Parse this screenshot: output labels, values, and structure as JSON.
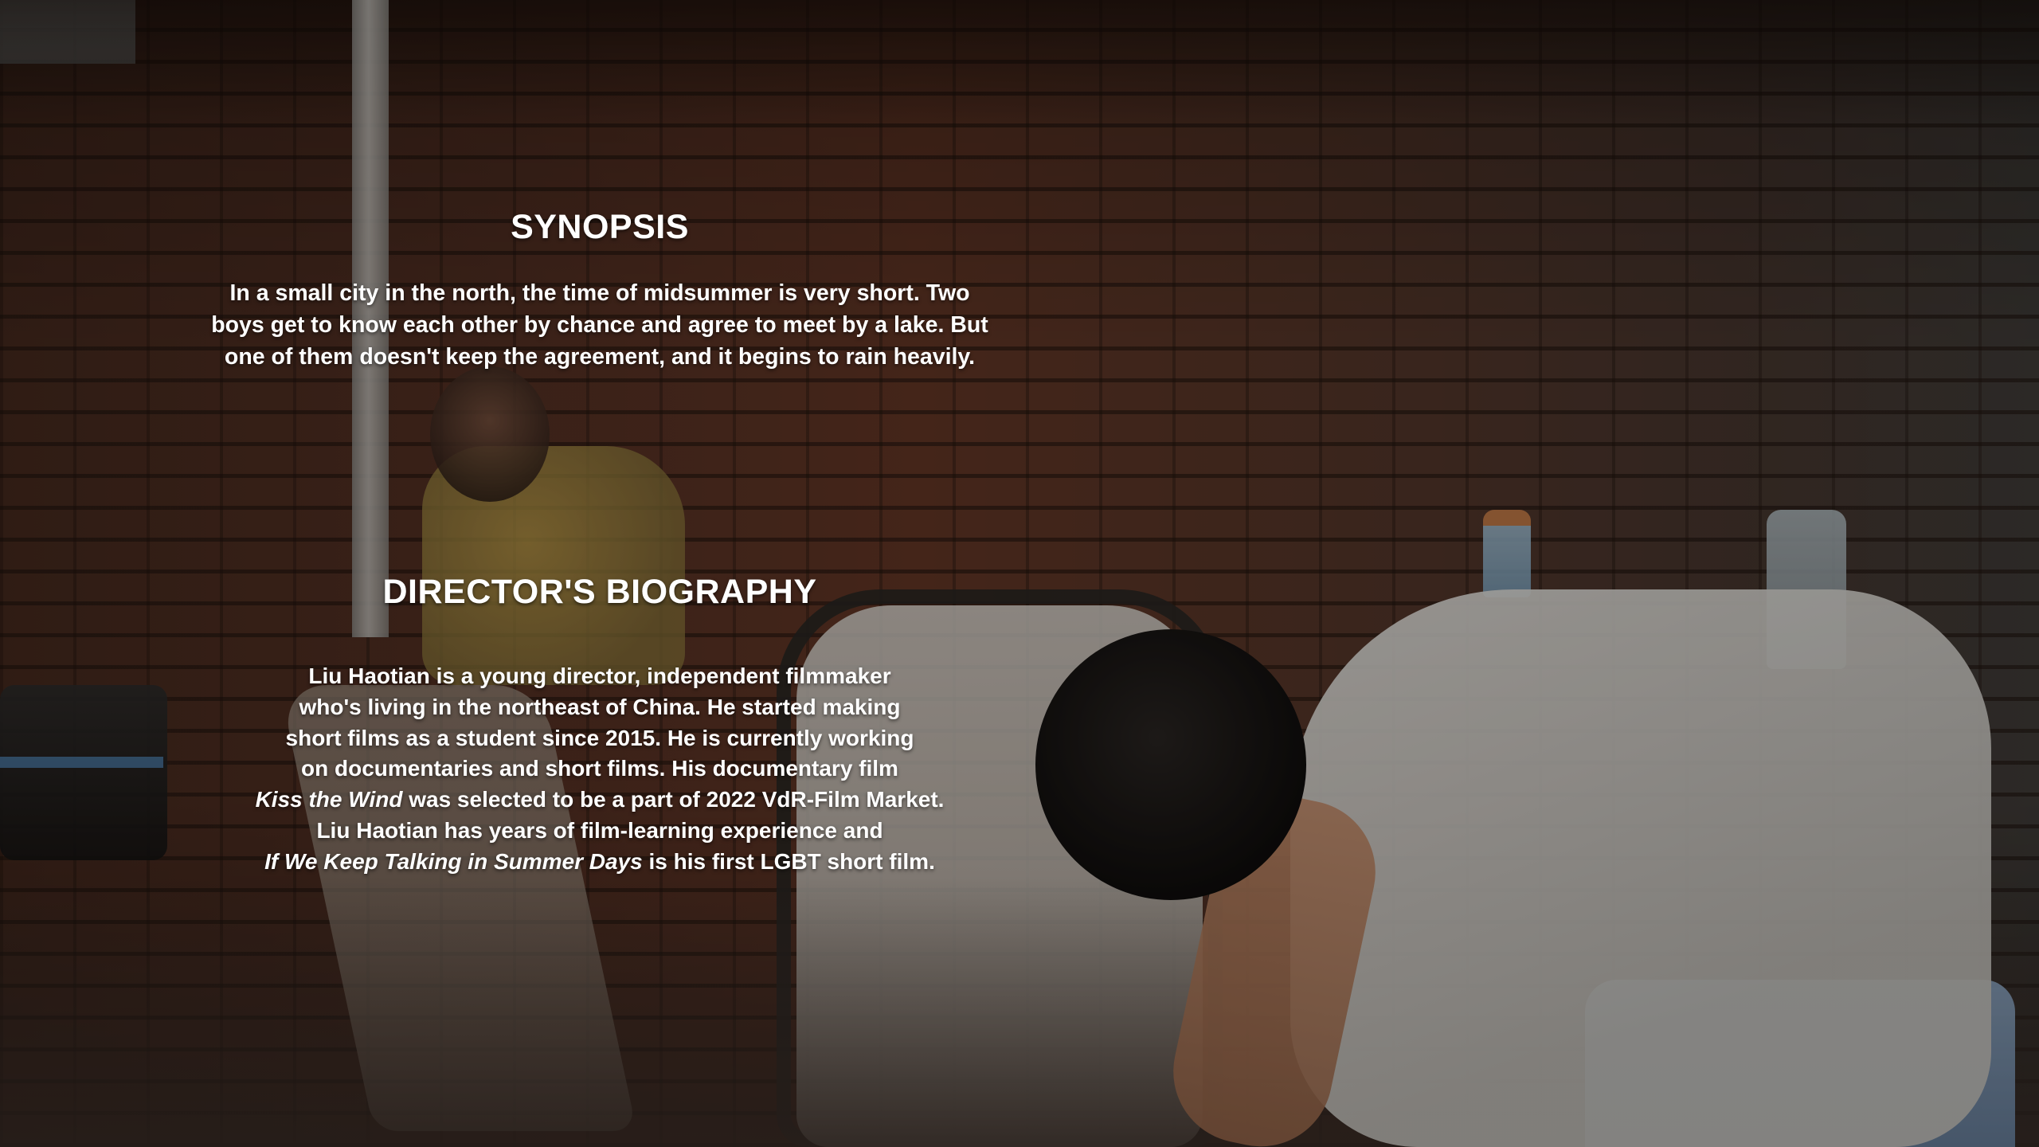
{
  "synopsis": {
    "heading": "SYNOPSIS",
    "lines": [
      "In a small city in the north, the time of midsummer is very short. Two",
      "boys get to know each other by chance and agree to meet by a lake. But",
      "one of them doesn't keep the agreement, and it begins to rain heavily."
    ]
  },
  "biography": {
    "heading": "DIRECTOR'S BIOGRAPHY",
    "director_name": "Liu Haotian",
    "line1_rest": " is a young director, independent filmmaker",
    "line2": "who's living in the northeast of China. He started making",
    "line3": "short films as a student since 2015. He is currently working",
    "line4": "on documentaries and short films. His documentary film",
    "line5_title": "Kiss the Wind",
    "line5_rest": " was selected to be a part of 2022 VdR-Film Market.",
    "line6": "Liu Haotian has years of film-learning experience and",
    "line7_title": "If We Keep Talking in Summer Days",
    "line7_rest": " is his first LGBT short film."
  }
}
